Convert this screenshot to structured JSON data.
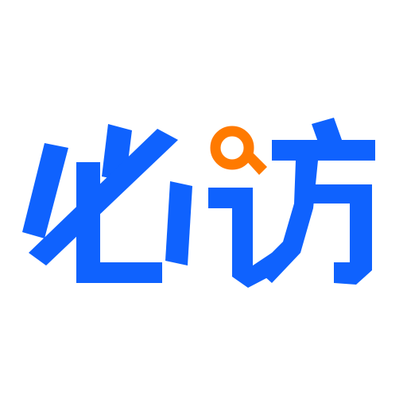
{
  "logo": {
    "wordmark": "必访",
    "colors": {
      "primary": "#0f62fe",
      "accent": "#ff7a00",
      "background": "#ffffff"
    },
    "icons": [
      "magnifier-dot-icon"
    ]
  }
}
